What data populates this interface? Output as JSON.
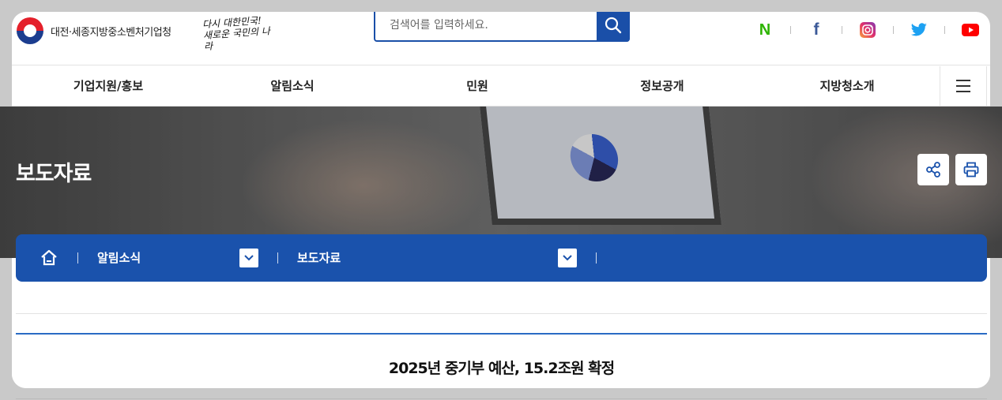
{
  "header": {
    "agency_name": "대전·세종지방중소벤처기업청",
    "slogan_line1": "다시 대한민국!",
    "slogan_line2": "새로운 국민의 나라",
    "search_placeholder": "검색어를 입력하세요.",
    "sns": [
      "naver-blog",
      "facebook",
      "instagram",
      "twitter",
      "youtube"
    ],
    "naver_label": "N",
    "facebook_label": "f"
  },
  "nav": {
    "items": [
      {
        "label": "기업지원/홍보"
      },
      {
        "label": "알림소식"
      },
      {
        "label": "민원"
      },
      {
        "label": "정보공개"
      },
      {
        "label": "지방청소개"
      }
    ]
  },
  "banner": {
    "page_title": "보도자료"
  },
  "breadcrumb": {
    "level1": "알림소식",
    "level2": "보도자료"
  },
  "article": {
    "title": "2025년 중기부 예산, 15.2조원 확정"
  },
  "colors": {
    "primary": "#1a52ac",
    "naver": "#2db400",
    "facebook": "#3b5998",
    "instagram": "#e1306c",
    "twitter": "#1da1f2",
    "youtube": "#ff0000"
  }
}
